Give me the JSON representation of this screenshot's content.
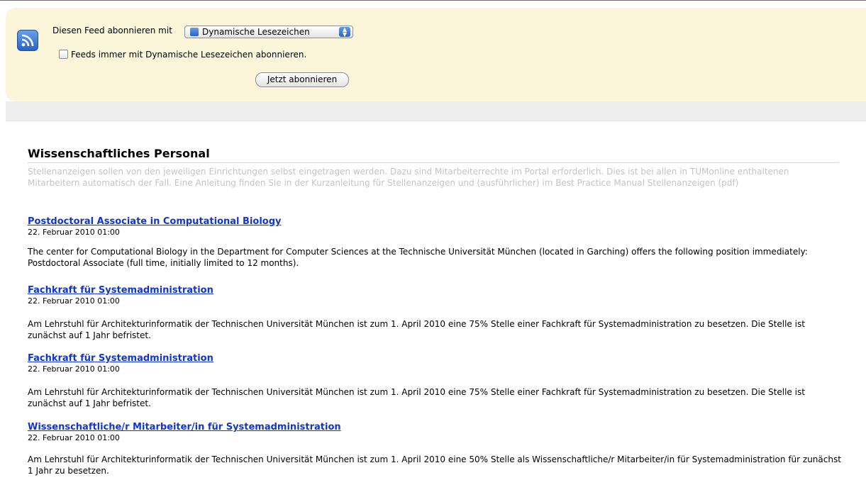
{
  "subscribe": {
    "label": "Diesen Feed abonnieren mit",
    "reader_selected": "Dynamische Lesezeichen",
    "always_use_label": "Feeds immer mit Dynamische Lesezeichen abonnieren.",
    "always_use_checked": false,
    "button_label": "Jetzt abonnieren"
  },
  "feed": {
    "title": "Wissenschaftliches Personal",
    "description": "Stellenanzeigen sollen von den jeweiligen Einrichtungen selbst eingetragen werden. Dazu sind Mitarbeiterrechte im Portal erforderlich. Dies ist bei allen in TUMonline enthaltenen Mitarbeitern automatisch der Fall. Eine Anleitung finden Sie in der Kurzanleitung für Stellenanzeigen und (ausführlicher) im Best Practice Manual Stellenanzeigen (pdf)"
  },
  "entries": [
    {
      "title": "Postdoctoral Associate in Computational Biology",
      "date": "22. Februar 2010 01:00",
      "body": "The center for Computational Biology in the Department for Computer Sciences at the Technische Universität München (located in Garching) offers the following position immediately: Postdoctoral Associate (full time, initially limited to 12 months)."
    },
    {
      "title": "Fachkraft für Systemadministration",
      "date": "22. Februar 2010 01:00",
      "body": "Am Lehrstuhl für Architekturinformatik der Technischen Universität München ist zum 1. April 2010 eine 75% Stelle einer Fachkraft für Systemadministration zu besetzen. Die Stelle ist zunächst auf 1 Jahr befristet."
    },
    {
      "title": "Fachkraft für Systemadministration",
      "date": "22. Februar 2010 01:00",
      "body": "Am Lehrstuhl für Architekturinformatik der Technischen Universität München ist zum 1. April 2010 eine 75% Stelle einer Fachkraft für Systemadministration zu besetzen. Die Stelle ist zunächst auf 1 Jahr befristet."
    },
    {
      "title": "Wissenschaftliche/r Mitarbeiter/in für Systemadministration",
      "date": "22. Februar 2010 01:00",
      "body": "Am Lehrstuhl für Architekturinformatik der Technischen Universität München ist zum 1. April 2010 eine 50% Stelle als Wissenschaftliche/r Mitarbeiter/in für Systemadministration für zunächst 1 Jahr zu besetzen."
    }
  ],
  "colors": {
    "subscribe_bg": "#fbf6da",
    "link": "#1136cf",
    "description_text": "#c4c4c4"
  },
  "icons": {
    "feed": "feed-icon",
    "reader_feed": "feed-icon",
    "stepper": "chevron-up-down-icon",
    "checkbox": "checkbox-icon"
  }
}
